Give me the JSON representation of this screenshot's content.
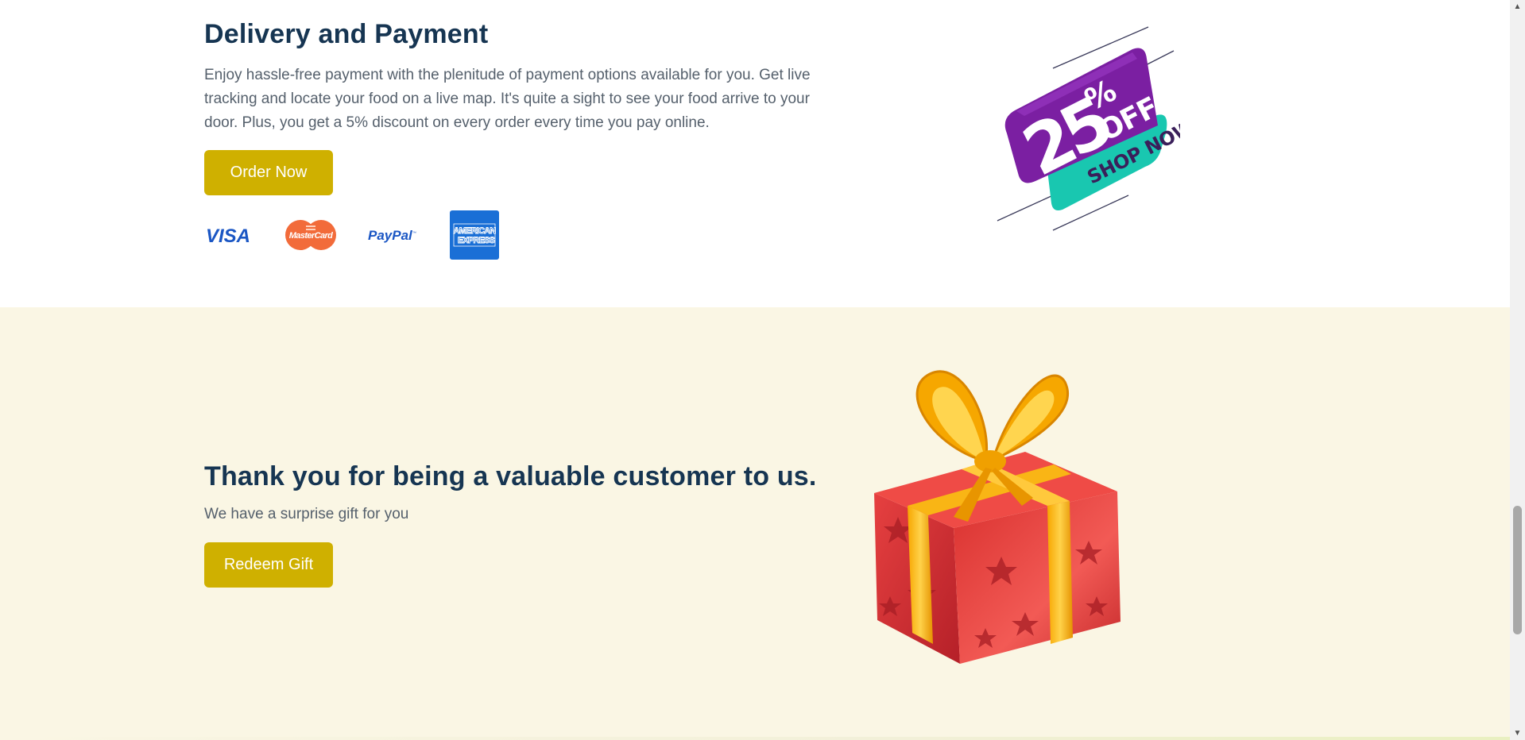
{
  "delivery": {
    "title": "Delivery and Payment",
    "text": "Enjoy hassle-free payment with the plenitude of payment options available for you. Get live tracking and locate your food on a live map. It's quite a sight to see your food arrive to your door. Plus, you get a 5% discount on every order every time you pay online.",
    "order_button": "Order Now",
    "payment_icons": [
      "visa-logo",
      "mastercard-logo",
      "paypal-logo",
      "american-express-logo"
    ],
    "promo_image": {
      "line1": "25",
      "line2": "%",
      "line3": "OFF",
      "line4": "SHOP NOW"
    }
  },
  "gift": {
    "title": "Thank you for being a valuable customer to us.",
    "subtitle": "We have a surprise gift for you",
    "redeem_button": "Redeem Gift",
    "image": "gift-box-image"
  },
  "colors": {
    "heading": "#163552",
    "body_text": "#55606c",
    "button_bg": "#cfb000",
    "section2_bg": "#faf6e4",
    "promo_purple": "#7b1fa2",
    "promo_teal": "#19c7b0"
  }
}
